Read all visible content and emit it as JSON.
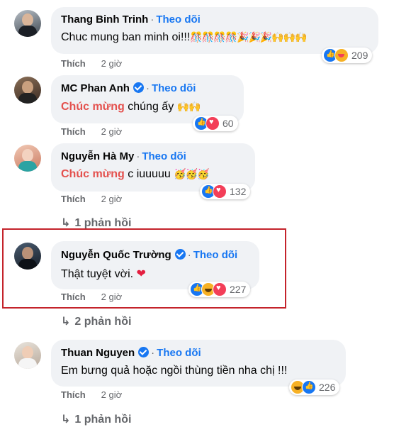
{
  "comments": [
    {
      "name": "Thang Binh Trinh",
      "follow": "Theo dõi",
      "text": "Chuc mung ban minh oi!!!",
      "emoji": "🎊🎊🎊🎊🎉🎉🎉🙌🙌🙌",
      "reaction_count": "209",
      "like": "Thích",
      "time": "2 giờ"
    },
    {
      "name": "MC Phan Anh",
      "follow": "Theo dõi",
      "text_highlight": "Chúc mừng",
      "text": " chúng ấy ",
      "emoji": "🙌🙌",
      "reaction_count": "60",
      "like": "Thích",
      "time": "2 giờ"
    },
    {
      "name": "Nguyễn Hà My",
      "follow": "Theo dõi",
      "text_highlight": "Chúc mừng",
      "text": " c iuuuuu ",
      "emoji": "🥳🥳🥳",
      "reaction_count": "132",
      "like": "Thích",
      "time": "2 giờ",
      "replies": "1 phản hồi"
    },
    {
      "name": "Nguyễn Quốc Trường",
      "follow": "Theo dõi",
      "text": "Thật tuyệt vời. ",
      "emoji": "❤",
      "reaction_count": "227",
      "like": "Thích",
      "time": "2 giờ",
      "replies": "2 phản hồi"
    },
    {
      "name": "Thuan Nguyen",
      "follow": "Theo dõi",
      "text": "Em bưng quả hoặc ngồi thùng tiền nha chị !!!",
      "reaction_count": "226",
      "like": "Thích",
      "time": "2 giờ",
      "replies": "1 phản hồi"
    }
  ],
  "colors": {
    "accent": "#1877f2",
    "highlight_box": "#c4232b",
    "bubble": "#f0f2f5"
  }
}
